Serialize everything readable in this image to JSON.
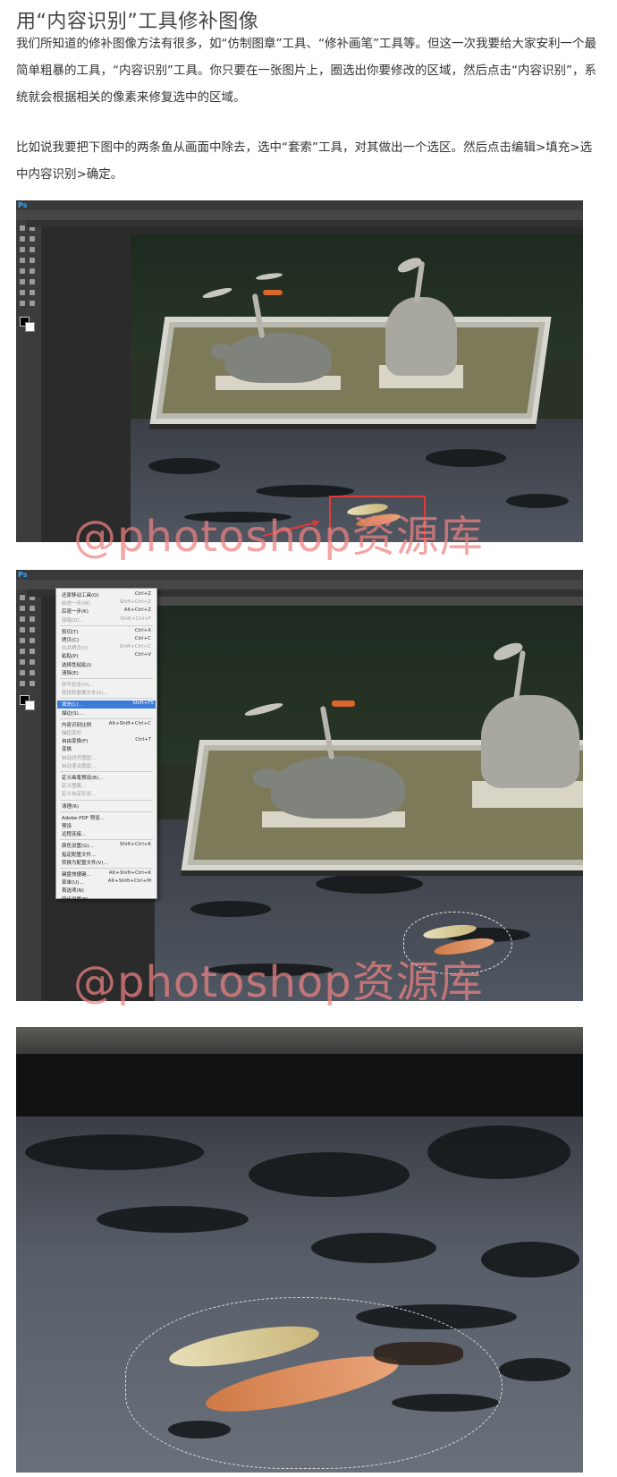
{
  "article": {
    "title": "用“内容识别”工具修补图像",
    "paragraph1": "我们所知道的修补图像方法有很多，如“仿制图章”工具、“修补画笔”工具等。但这一次我要给大家安利一个最简单粗暴的工具，“内容识别”工具。你只要在一张图片上，圈选出你要修改的区域，然后点击“内容识别”，系统就会根据相关的像素来修复选中的区域。",
    "paragraph2": "比如说我要把下图中的两条鱼从画面中除去，选中“套索”工具，对其做出一个选区。然后点击编辑>填充>选中内容识别>确定。"
  },
  "watermark": {
    "text": "@photoshop资源库",
    "color": "#ee8282"
  },
  "screenshot2_menu": {
    "items": [
      {
        "label": "还原移动工具(O)",
        "shortcut": "Ctrl+Z",
        "state": "normal"
      },
      {
        "label": "前进一步(W)",
        "shortcut": "Shift+Ctrl+Z",
        "state": "disabled"
      },
      {
        "label": "后退一步(K)",
        "shortcut": "Alt+Ctrl+Z",
        "state": "normal"
      },
      {
        "label": "渐隐(D)...",
        "shortcut": "Shift+Ctrl+F",
        "state": "disabled"
      },
      {
        "label": "剪切(T)",
        "shortcut": "Ctrl+X",
        "state": "normal"
      },
      {
        "label": "拷贝(C)",
        "shortcut": "Ctrl+C",
        "state": "normal"
      },
      {
        "label": "合并拷贝(Y)",
        "shortcut": "Shift+Ctrl+C",
        "state": "disabled"
      },
      {
        "label": "粘贴(P)",
        "shortcut": "Ctrl+V",
        "state": "normal"
      },
      {
        "label": "选择性粘贴(I)",
        "shortcut": "",
        "state": "normal"
      },
      {
        "label": "清除(E)",
        "shortcut": "",
        "state": "normal"
      },
      {
        "label": "拼写检查(H)...",
        "shortcut": "",
        "state": "disabled"
      },
      {
        "label": "查找和替换文本(X)...",
        "shortcut": "",
        "state": "disabled"
      },
      {
        "label": "填充(L)...",
        "shortcut": "Shift+F5",
        "state": "highlighted"
      },
      {
        "label": "描边(S)...",
        "shortcut": "",
        "state": "normal"
      },
      {
        "label": "内容识别比例",
        "shortcut": "Alt+Shift+Ctrl+C",
        "state": "normal"
      },
      {
        "label": "操控变形",
        "shortcut": "",
        "state": "disabled"
      },
      {
        "label": "自由变换(F)",
        "shortcut": "Ctrl+T",
        "state": "normal"
      },
      {
        "label": "变换",
        "shortcut": "",
        "state": "normal"
      },
      {
        "label": "自动对齐图层...",
        "shortcut": "",
        "state": "disabled"
      },
      {
        "label": "自动混合图层...",
        "shortcut": "",
        "state": "disabled"
      },
      {
        "label": "定义画笔预设(B)...",
        "shortcut": "",
        "state": "normal"
      },
      {
        "label": "定义图案...",
        "shortcut": "",
        "state": "disabled"
      },
      {
        "label": "定义自定形状...",
        "shortcut": "",
        "state": "disabled"
      },
      {
        "label": "清理(R)",
        "shortcut": "",
        "state": "normal"
      },
      {
        "label": "Adobe PDF 预设...",
        "shortcut": "",
        "state": "normal"
      },
      {
        "label": "预设",
        "shortcut": "",
        "state": "normal"
      },
      {
        "label": "远程连接...",
        "shortcut": "",
        "state": "normal"
      },
      {
        "label": "颜色设置(G)...",
        "shortcut": "Shift+Ctrl+K",
        "state": "normal"
      },
      {
        "label": "指定配置文件...",
        "shortcut": "",
        "state": "normal"
      },
      {
        "label": "转换为配置文件(V)...",
        "shortcut": "",
        "state": "normal"
      },
      {
        "label": "键盘快捷键...",
        "shortcut": "Alt+Shift+Ctrl+K",
        "state": "normal"
      },
      {
        "label": "菜单(U)...",
        "shortcut": "Alt+Shift+Ctrl+M",
        "state": "normal"
      },
      {
        "label": "首选项(N)",
        "shortcut": "",
        "state": "normal"
      },
      {
        "label": "同步设置(E)",
        "shortcut": "",
        "state": "normal"
      }
    ]
  }
}
